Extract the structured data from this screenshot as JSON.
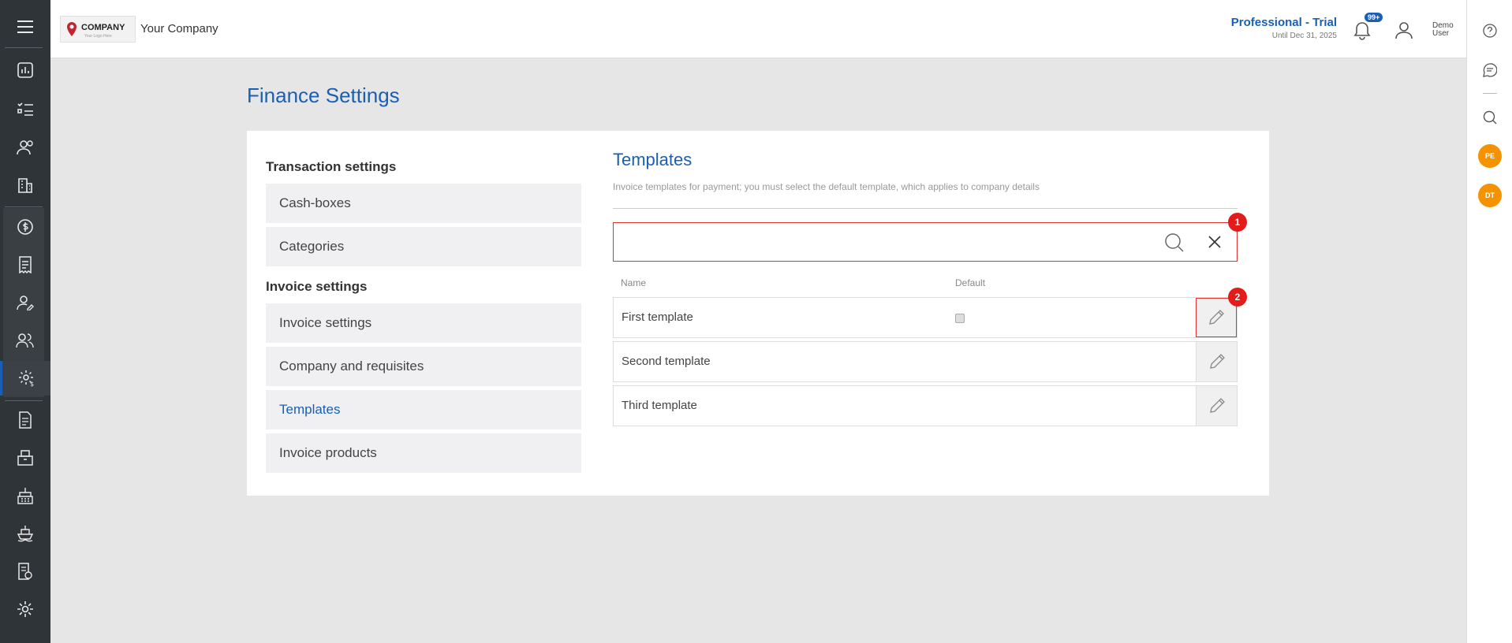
{
  "header": {
    "logo_text": "COMPANY",
    "logo_tagline": "Your Logo Here",
    "company_name": "Your Company",
    "plan_title": "Professional - Trial",
    "plan_until": "Until Dec 31, 2025",
    "notifications_badge": "99+",
    "user_name": "Demo User"
  },
  "left_nav": {
    "items": [
      {
        "icon": "menu-icon"
      },
      {
        "icon": "dashboard-icon"
      },
      {
        "icon": "tasks-icon"
      },
      {
        "icon": "contacts-icon"
      },
      {
        "icon": "companies-icon"
      },
      {
        "icon": "finance-icon"
      },
      {
        "icon": "invoices-icon"
      },
      {
        "icon": "user-edit-icon"
      },
      {
        "icon": "users-icon"
      },
      {
        "icon": "finance-settings-icon"
      },
      {
        "icon": "documents-icon"
      },
      {
        "icon": "products-icon"
      },
      {
        "icon": "warehouse-icon"
      },
      {
        "icon": "shipping-icon"
      },
      {
        "icon": "reports-icon"
      },
      {
        "icon": "settings-icon"
      }
    ]
  },
  "right_nav": {
    "avatars": [
      "PE",
      "DT"
    ]
  },
  "page": {
    "title": "Finance Settings"
  },
  "settings_menu": {
    "transaction_section": "Transaction settings",
    "transaction_items": [
      "Cash-boxes",
      "Categories"
    ],
    "invoice_section": "Invoice settings",
    "invoice_items": [
      "Invoice settings",
      "Company and requisites",
      "Templates",
      "Invoice products"
    ],
    "selected": "Templates"
  },
  "templates": {
    "title": "Templates",
    "description": "Invoice templates for payment; you must select the default template, which applies to company details",
    "search_value": "",
    "columns": {
      "name": "Name",
      "default": "Default"
    },
    "rows": [
      {
        "name": "First template",
        "default": false
      },
      {
        "name": "Second template",
        "default": null
      },
      {
        "name": "Third template",
        "default": null
      }
    ],
    "step_badges": [
      "1",
      "2"
    ]
  },
  "colors": {
    "accent": "#1a5fb4",
    "sidebar": "#2f3438",
    "highlight": "#e21b1b",
    "avatar": "#f59200"
  }
}
